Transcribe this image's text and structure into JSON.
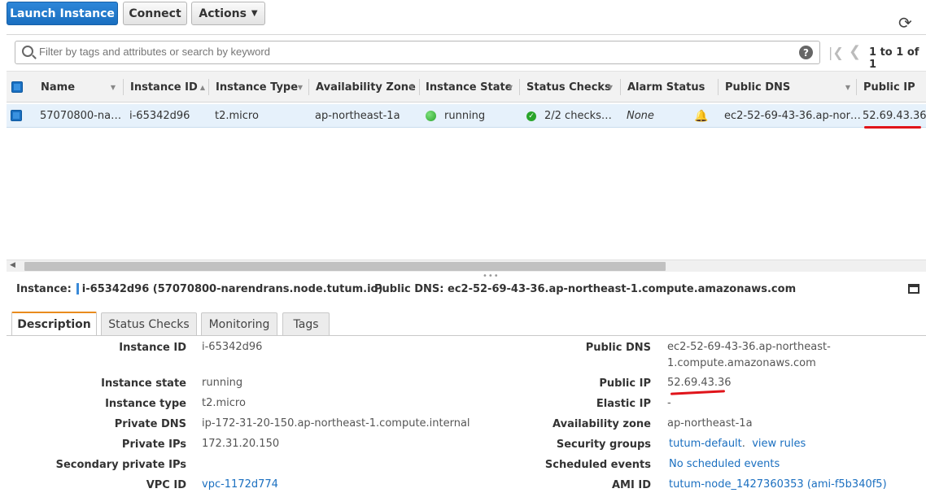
{
  "toolbar": {
    "launch_label": "Launch Instance",
    "connect_label": "Connect",
    "actions_label": "Actions"
  },
  "search": {
    "placeholder": "Filter by tags and attributes or search by keyword",
    "pager_text": "1 to 1 of 1"
  },
  "table": {
    "headers": [
      "Name",
      "Instance ID",
      "Instance Type",
      "Availability Zone",
      "Instance State",
      "Status Checks",
      "Alarm Status",
      "Public DNS",
      "Public IP"
    ],
    "row": {
      "name": "57070800-na…",
      "instance_id": "i-65342d96",
      "instance_type": "t2.micro",
      "availability_zone": "ap-northeast-1a",
      "instance_state": "running",
      "status_checks": "2/2 checks…",
      "alarm_status": "None",
      "public_dns": "ec2-52-69-43-36.ap-nor…",
      "public_ip": "52.69.43.36"
    }
  },
  "info": {
    "instance_label": "Instance:",
    "instance_value": "i-65342d96 (57070800-narendrans.node.tutum.io)",
    "dns_label": "Public DNS:",
    "dns_value": "ec2-52-69-43-36.ap-northeast-1.compute.amazonaws.com"
  },
  "tabs": [
    "Description",
    "Status Checks",
    "Monitoring",
    "Tags"
  ],
  "description": {
    "left": [
      {
        "label": "Instance ID",
        "value": "i-65342d96"
      },
      {
        "label": "Instance state",
        "value": "running"
      },
      {
        "label": "Instance type",
        "value": "t2.micro"
      },
      {
        "label": "Private DNS",
        "value": "ip-172-31-20-150.ap-northeast-1.compute.internal"
      },
      {
        "label": "Private IPs",
        "value": "172.31.20.150"
      },
      {
        "label": "Secondary private IPs",
        "value": ""
      },
      {
        "label": "VPC ID",
        "value": "vpc-1172d774"
      }
    ],
    "right": [
      {
        "label": "Public DNS",
        "value": "ec2-52-69-43-36.ap-northeast-",
        "value2": "1.compute.amazonaws.com"
      },
      {
        "label": "Public IP",
        "value": "52.69.43.36"
      },
      {
        "label": "Elastic IP",
        "value": "-"
      },
      {
        "label": "Availability zone",
        "value": "ap-northeast-1a"
      },
      {
        "label": "Security groups",
        "value": "tutum-default",
        "value_sep": ".",
        "value_link2": "view rules"
      },
      {
        "label": "Scheduled events",
        "value": "No scheduled events"
      },
      {
        "label": "AMI ID",
        "value": "tutum-node_1427360353 (ami-f5b340f5)"
      }
    ]
  },
  "colors": {
    "primary": "#1a6fc0",
    "accent_tab": "#e98b1d",
    "running": "#2aa52a",
    "annotation_red": "#e0141a"
  }
}
